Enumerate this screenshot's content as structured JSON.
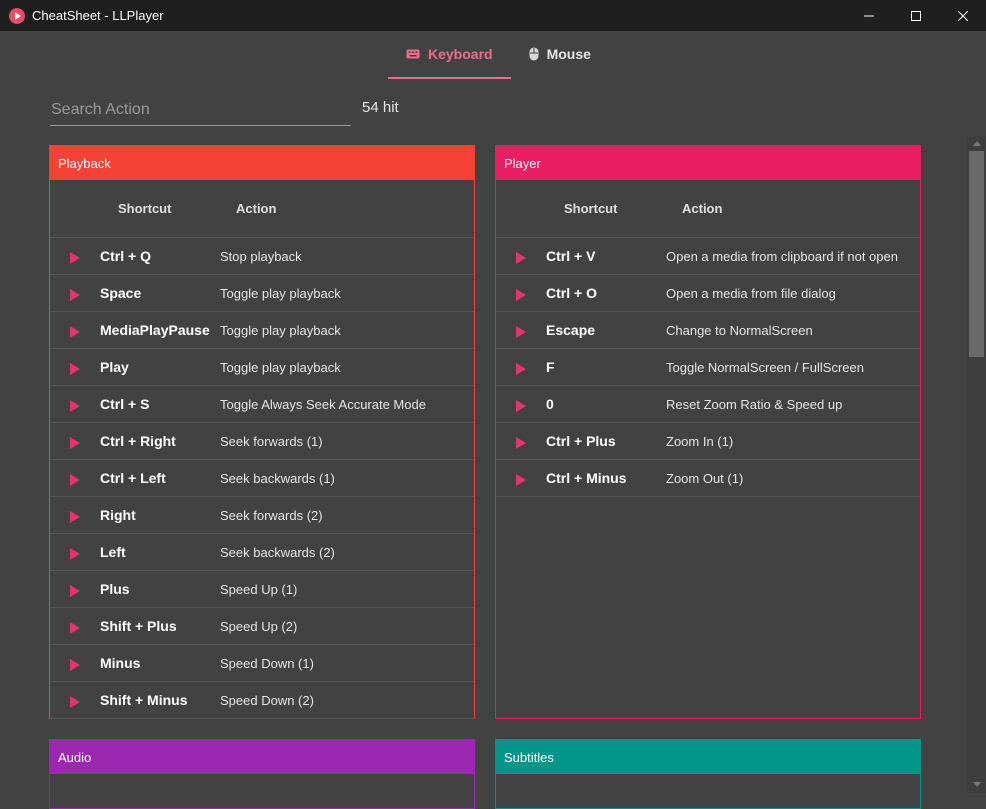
{
  "window": {
    "title": "CheatSheet - LLPlayer"
  },
  "tabs": [
    {
      "label": "Keyboard",
      "icon": "keyboard-icon",
      "active": true
    },
    {
      "label": "Mouse",
      "icon": "mouse-icon",
      "active": false
    }
  ],
  "search": {
    "placeholder": "Search Action",
    "value": ""
  },
  "hits": "54 hit",
  "columns": {
    "shortcut": "Shortcut",
    "action": "Action"
  },
  "colors": {
    "accent": "#f06a8c",
    "playback": "#f44336",
    "player": "#e91e63",
    "audio": "#9c27b0",
    "subtitles": "#009688"
  },
  "groups": {
    "playback": {
      "title": "Playback",
      "rows": [
        {
          "key": "Ctrl + Q",
          "action": "Stop playback"
        },
        {
          "key": "Space",
          "action": "Toggle play playback"
        },
        {
          "key": "MediaPlayPause",
          "action": "Toggle play playback"
        },
        {
          "key": "Play",
          "action": "Toggle play playback"
        },
        {
          "key": "Ctrl + S",
          "action": "Toggle Always Seek Accurate Mode"
        },
        {
          "key": "Ctrl + Right",
          "action": "Seek forwards (1)"
        },
        {
          "key": "Ctrl + Left",
          "action": "Seek backwards (1)"
        },
        {
          "key": "Right",
          "action": "Seek forwards (2)"
        },
        {
          "key": "Left",
          "action": "Seek backwards (2)"
        },
        {
          "key": "Plus",
          "action": "Speed Up (1)"
        },
        {
          "key": "Shift + Plus",
          "action": "Speed Up (2)"
        },
        {
          "key": "Minus",
          "action": "Speed Down (1)"
        },
        {
          "key": "Shift + Minus",
          "action": "Speed Down (2)"
        }
      ]
    },
    "player": {
      "title": "Player",
      "rows": [
        {
          "key": "Ctrl + V",
          "action": "Open a media from clipboard if not open"
        },
        {
          "key": "Ctrl + O",
          "action": "Open a media from file dialog"
        },
        {
          "key": "Escape",
          "action": "Change to NormalScreen"
        },
        {
          "key": "F",
          "action": "Toggle NormalScreen / FullScreen"
        },
        {
          "key": "0",
          "action": "Reset Zoom Ratio & Speed up"
        },
        {
          "key": "Ctrl + Plus",
          "action": "Zoom In (1)"
        },
        {
          "key": "Ctrl + Minus",
          "action": "Zoom Out (1)"
        }
      ]
    },
    "audio": {
      "title": "Audio"
    },
    "subtitles": {
      "title": "Subtitles"
    }
  }
}
